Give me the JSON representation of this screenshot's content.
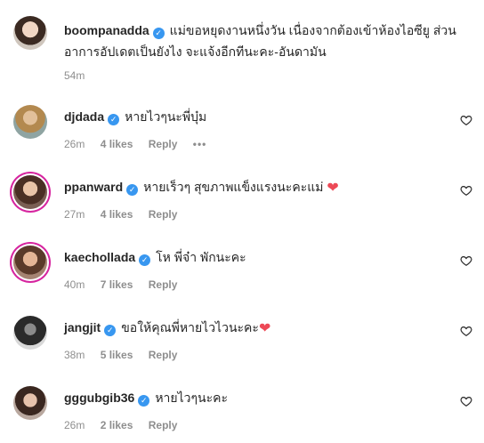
{
  "post": {
    "username": "boompanadda",
    "caption": "แม่ขอหยุดงานหนึ่งวัน เนื่องจากต้องเข้าห้องไอซียู ส่วนอาการอัปเดตเป็นยังไง จะแจ้งอีกทีนะคะ-อันดามัน",
    "time": "54m"
  },
  "comments": [
    {
      "username": "djdada",
      "text": "หายไวๆนะพี่บุ๋ม",
      "heart": "",
      "time": "26m",
      "likes": "4 likes",
      "reply": "Reply",
      "more": "•••"
    },
    {
      "username": "ppanward",
      "text": "หายเร็วๆ สุขภาพแข็งแรงนะคะแม่",
      "heart": "❤",
      "time": "27m",
      "likes": "4 likes",
      "reply": "Reply",
      "more": ""
    },
    {
      "username": "kaechollada",
      "text": "โห พี่จ๋า พักนะคะ",
      "heart": "",
      "time": "40m",
      "likes": "7 likes",
      "reply": "Reply",
      "more": ""
    },
    {
      "username": "jangjit",
      "text": "ขอให้คุณพี่หายไวไวนะคะ",
      "heart": "❤",
      "time": "38m",
      "likes": "5 likes",
      "reply": "Reply",
      "more": ""
    },
    {
      "username": "gggubgib36",
      "text": "หายไวๆนะคะ",
      "heart": "",
      "time": "26m",
      "likes": "2 likes",
      "reply": "Reply",
      "more": ""
    }
  ],
  "icons": {
    "verified": "verified-badge-icon",
    "like": "heart-outline-icon"
  },
  "colors": {
    "verified": "#3897f0",
    "muted": "#8e8e8e",
    "heart": "#ed4956"
  }
}
